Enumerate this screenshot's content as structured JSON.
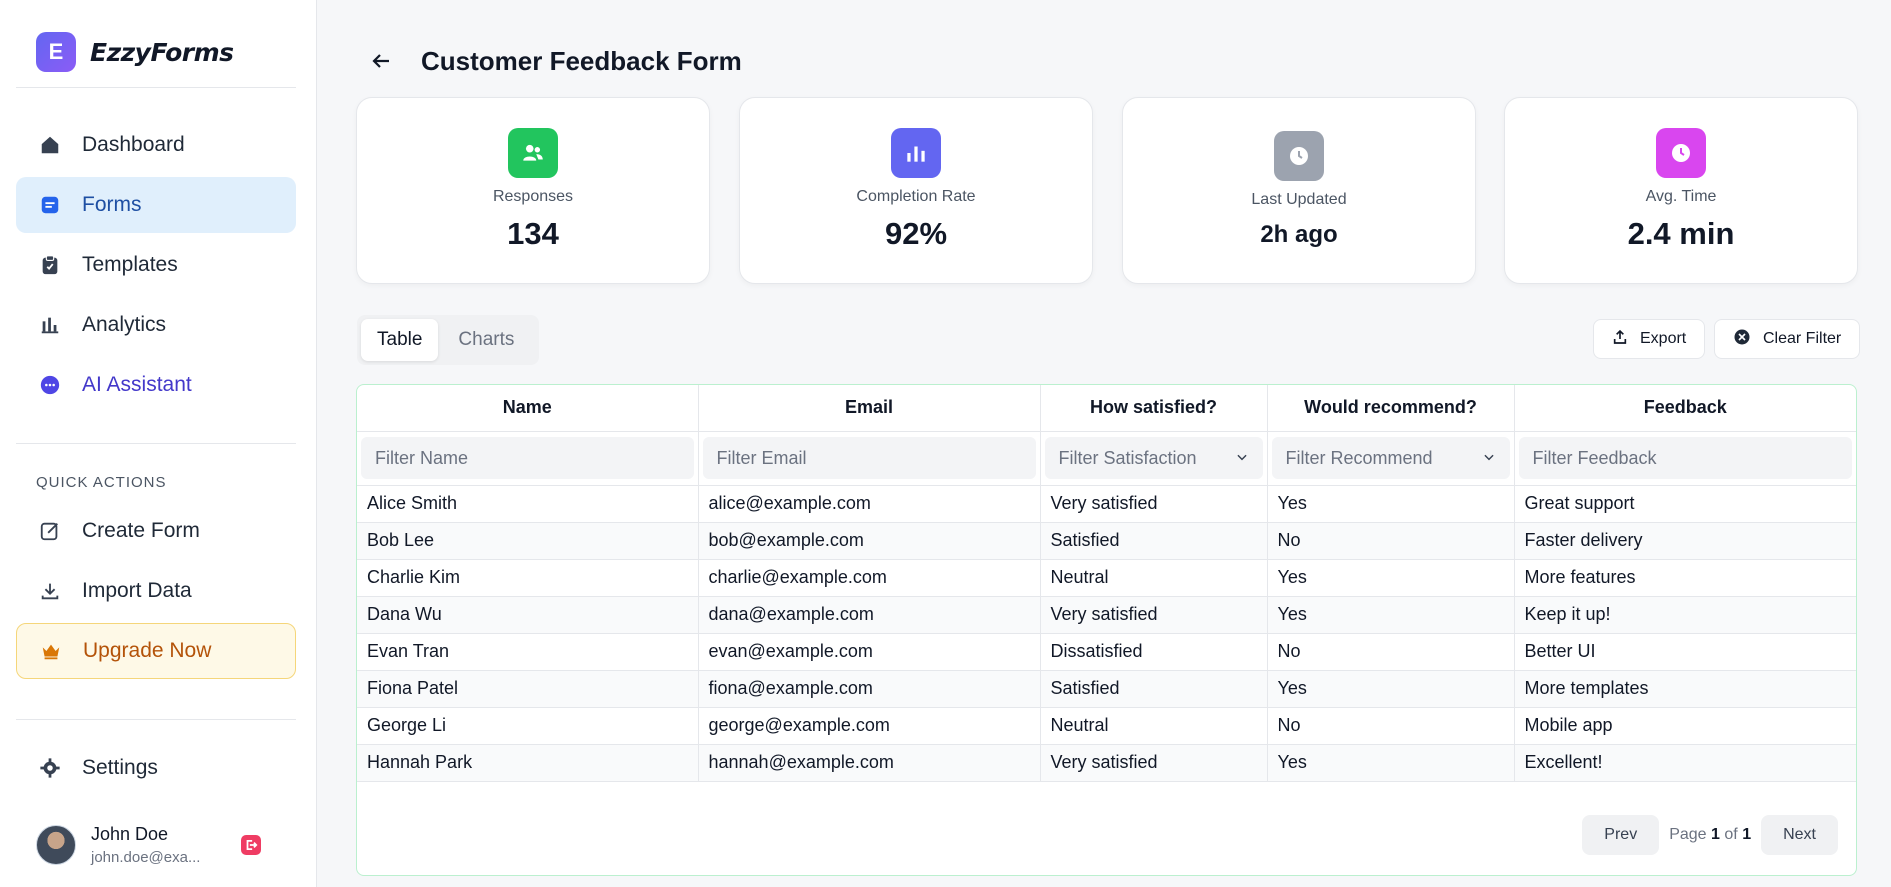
{
  "brand": {
    "logo_letter": "E",
    "name": "EzzyForms"
  },
  "sidebar": {
    "nav": [
      {
        "label": "Dashboard",
        "icon": "home-icon"
      },
      {
        "label": "Forms",
        "icon": "form-icon"
      },
      {
        "label": "Templates",
        "icon": "clipboard-icon"
      },
      {
        "label": "Analytics",
        "icon": "bar-chart-icon"
      },
      {
        "label": "AI Assistant",
        "icon": "chat-icon"
      }
    ],
    "quick_actions_label": "QUICK ACTIONS",
    "quick_actions": [
      {
        "label": "Create Form",
        "icon": "edit-icon"
      },
      {
        "label": "Import Data",
        "icon": "download-icon"
      },
      {
        "label": "Upgrade Now",
        "icon": "crown-icon"
      }
    ],
    "settings_label": "Settings",
    "user": {
      "name": "John Doe",
      "email": "john.doe@exa..."
    }
  },
  "header": {
    "title": "Customer Feedback Form"
  },
  "stats": [
    {
      "label": "Responses",
      "value": "134",
      "icon": "users-icon",
      "color": "#22c55e"
    },
    {
      "label": "Completion Rate",
      "value": "92%",
      "icon": "bar-chart-icon",
      "color": "#6366f1"
    },
    {
      "label": "Last Updated",
      "value": "2h ago",
      "icon": "clock-icon",
      "color": "#9ca3af"
    },
    {
      "label": "Avg. Time",
      "value": "2.4 min",
      "icon": "clock-icon",
      "color": "#d946ef"
    }
  ],
  "tabs": {
    "table": "Table",
    "charts": "Charts"
  },
  "toolbar": {
    "export": "Export",
    "clear_filter": "Clear Filter"
  },
  "table": {
    "headers": [
      "Name",
      "Email",
      "How satisfied?",
      "Would recommend?",
      "Feedback"
    ],
    "filters": [
      "Filter Name",
      "Filter Email",
      "Filter Satisfaction",
      "Filter Recommend",
      "Filter Feedback"
    ],
    "rows": [
      [
        "Alice Smith",
        "alice@example.com",
        "Very satisfied",
        "Yes",
        "Great support"
      ],
      [
        "Bob Lee",
        "bob@example.com",
        "Satisfied",
        "No",
        "Faster delivery"
      ],
      [
        "Charlie Kim",
        "charlie@example.com",
        "Neutral",
        "Yes",
        "More features"
      ],
      [
        "Dana Wu",
        "dana@example.com",
        "Very satisfied",
        "Yes",
        "Keep it up!"
      ],
      [
        "Evan Tran",
        "evan@example.com",
        "Dissatisfied",
        "No",
        "Better UI"
      ],
      [
        "Fiona Patel",
        "fiona@example.com",
        "Satisfied",
        "Yes",
        "More templates"
      ],
      [
        "George Li",
        "george@example.com",
        "Neutral",
        "No",
        "Mobile app"
      ],
      [
        "Hannah Park",
        "hannah@example.com",
        "Very satisfied",
        "Yes",
        "Excellent!"
      ]
    ]
  },
  "pagination": {
    "prev": "Prev",
    "page_word": "Page",
    "current": "1",
    "of_word": "of",
    "total": "1",
    "next": "Next"
  }
}
